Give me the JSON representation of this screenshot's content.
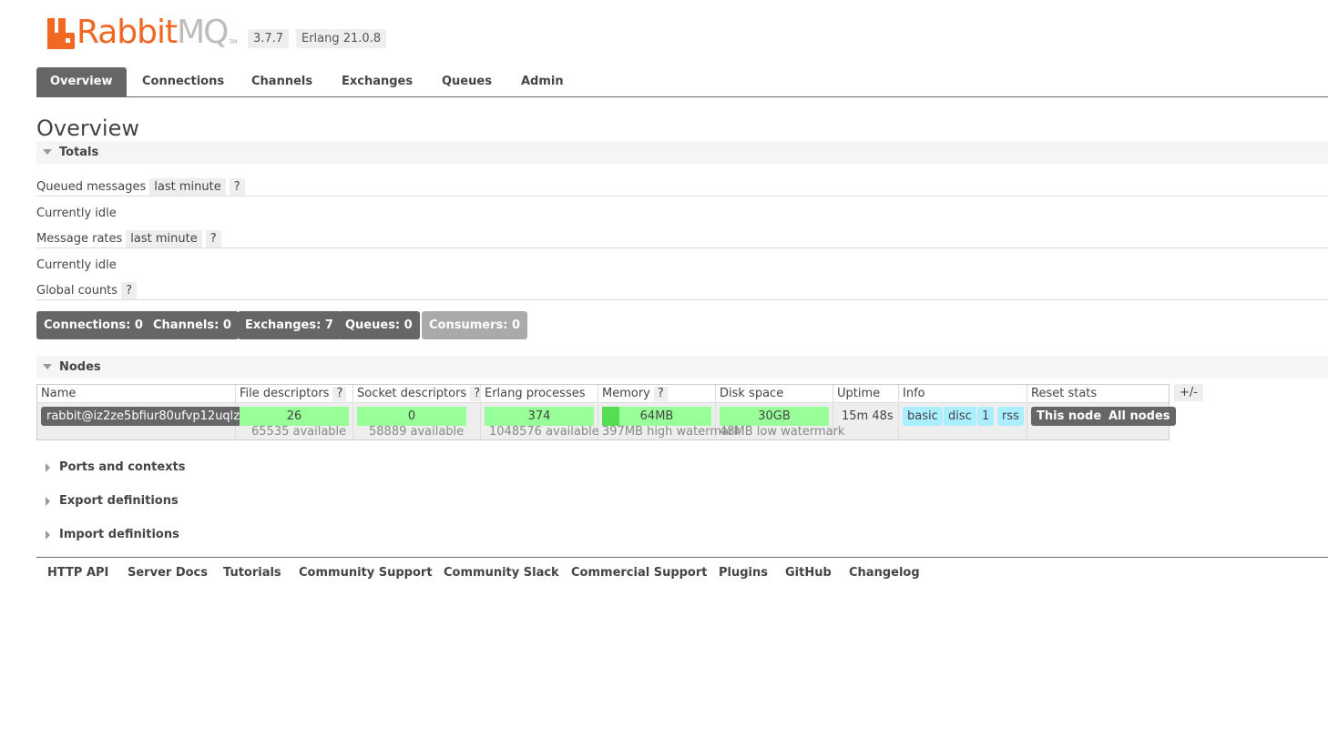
{
  "header": {
    "logo_text_rabbit": "Rabbit",
    "logo_text_mq": "MQ",
    "logo_tm": "TM",
    "version": "3.7.7",
    "erlang": "Erlang 21.0.8"
  },
  "colors": {
    "brand": "#f26822",
    "tab_active": "#666666",
    "bar_green": "#99ff99",
    "info_blue": "#aaeeff"
  },
  "tabs": [
    {
      "label": "Overview",
      "active": true
    },
    {
      "label": "Connections"
    },
    {
      "label": "Channels"
    },
    {
      "label": "Exchanges"
    },
    {
      "label": "Queues"
    },
    {
      "label": "Admin"
    }
  ],
  "page_title": "Overview",
  "totals": {
    "header": "Totals",
    "queued_label": "Queued messages",
    "queued_range": "last minute",
    "help": "?",
    "queued_status": "Currently idle",
    "rates_label": "Message rates",
    "rates_range": "last minute",
    "rates_status": "Currently idle",
    "global_label": "Global counts",
    "counts": [
      {
        "label": "Connections: 0"
      },
      {
        "label": "Channels: 0"
      },
      {
        "label": "Exchanges: 7"
      },
      {
        "label": "Queues: 0"
      },
      {
        "label": "Consumers: 0",
        "dim": true
      }
    ]
  },
  "nodes": {
    "header": "Nodes",
    "columns": [
      "Name",
      "File descriptors",
      "Socket descriptors",
      "Erlang processes",
      "Memory",
      "Disk space",
      "Uptime",
      "Info",
      "Reset stats"
    ],
    "toggle": "+/-",
    "row": {
      "name": "rabbit@iz2ze5bfiur80ufvp12uqlz",
      "file_descriptors": "26",
      "file_available": "65535 available",
      "file_fraction": 0.0004,
      "socket_descriptors": "0",
      "socket_available": "58889 available",
      "erlang_processes": "374",
      "erlang_available": "1048576 available",
      "memory": "64MB",
      "memory_watermark": "397MB high watermark",
      "memory_fraction": 0.16,
      "disk": "30GB",
      "disk_watermark": "48MB low watermark",
      "uptime": "15m 48s",
      "info": [
        "basic",
        "disc",
        "1",
        "rss"
      ],
      "reset_this": "This node",
      "reset_all": "All nodes"
    }
  },
  "collapsed_sections": [
    "Ports and contexts",
    "Export definitions",
    "Import definitions"
  ],
  "footer": [
    "HTTP API",
    "Server Docs",
    "Tutorials",
    "Community Support",
    "Community Slack",
    "Commercial Support",
    "Plugins",
    "GitHub",
    "Changelog"
  ]
}
